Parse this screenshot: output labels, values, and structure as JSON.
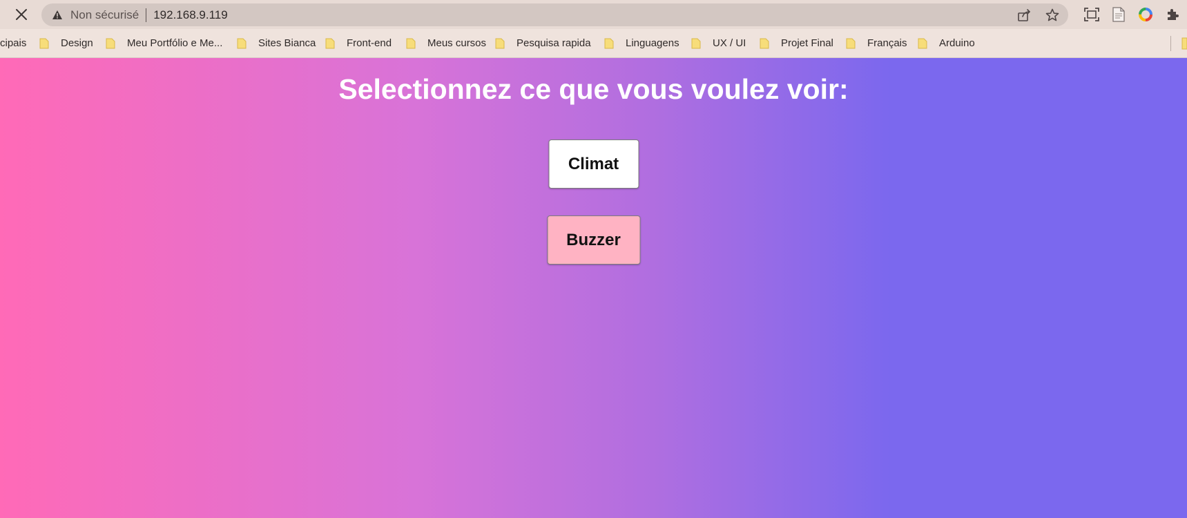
{
  "toolbar": {
    "security_label": "Non sécurisé",
    "url": "192.168.9.119",
    "icons": [
      "close-icon",
      "warning-icon",
      "share-icon",
      "star-icon",
      "screenshot-icon",
      "reading-mode-icon",
      "profile-ring-icon",
      "extensions-puzzle-icon"
    ]
  },
  "bookmarks": {
    "first_partial": "cipais",
    "items": [
      {
        "label": "Design"
      },
      {
        "label": "Meu Portfólio e Me..."
      },
      {
        "label": "Sites Bianca"
      },
      {
        "label": "Front-end"
      },
      {
        "label": "Meus cursos"
      },
      {
        "label": "Pesquisa rapida"
      },
      {
        "label": "Linguagens"
      },
      {
        "label": "UX / UI"
      },
      {
        "label": "Projet Final"
      },
      {
        "label": "Français"
      },
      {
        "label": "Arduino"
      }
    ]
  },
  "page": {
    "title": "Selectionnez ce que vous voulez voir:",
    "buttons": {
      "climat": "Climat",
      "buzzer": "Buzzer"
    }
  },
  "colors": {
    "gradient_start": "#ff6ab7",
    "gradient_end": "#7b68ee",
    "buzzer_button": "#ffb3c3",
    "climat_button": "#ffffff",
    "folder": "#f7dd7a"
  }
}
